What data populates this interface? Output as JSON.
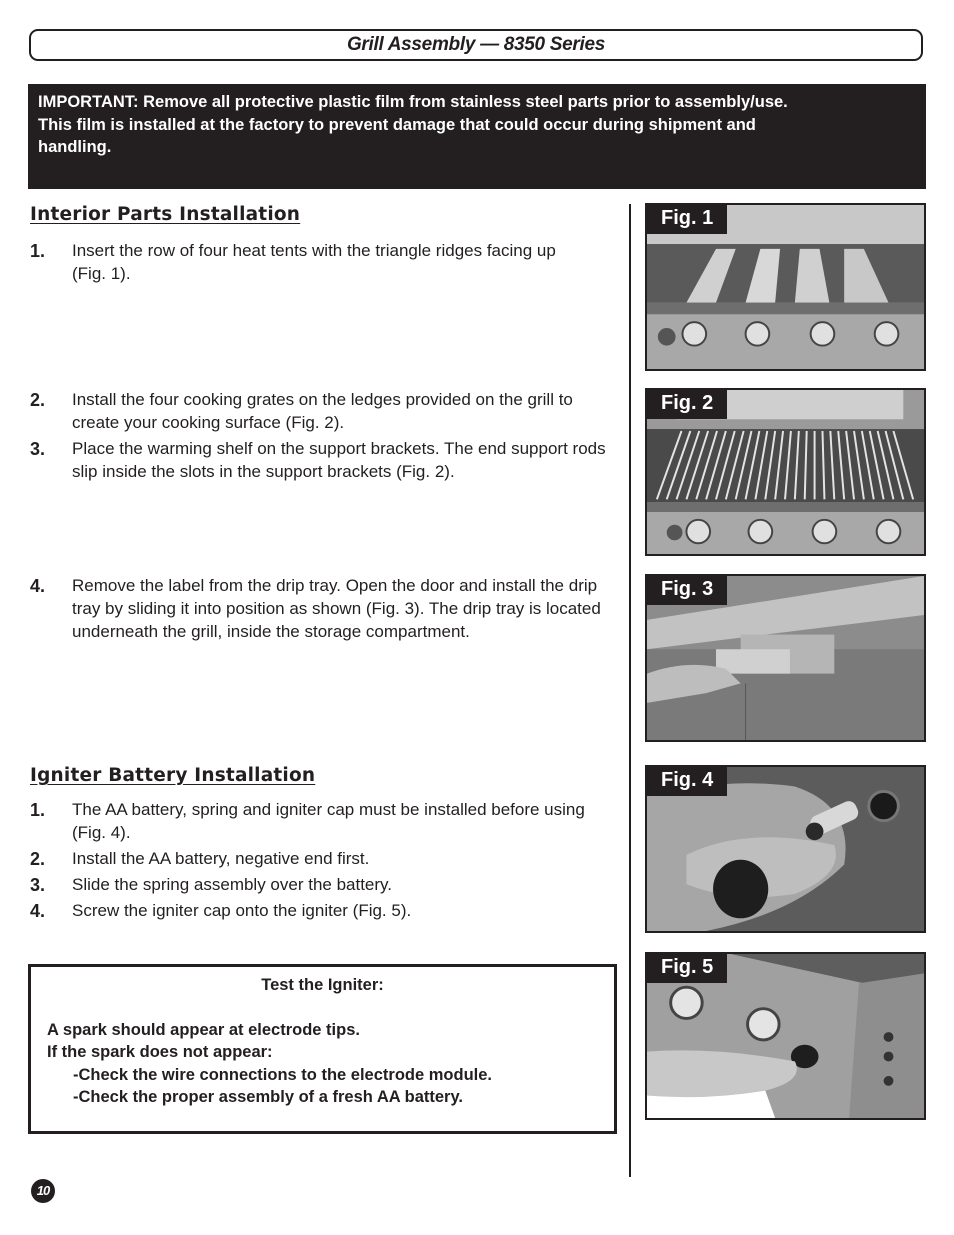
{
  "header": {
    "title": "Grill Assembly — 8350 Series"
  },
  "important_notice": {
    "lines": [
      "IMPORTANT: Remove all protective plastic film from stainless steel parts prior to assembly/use.",
      "This film is installed at the factory to prevent damage that could occur during shipment and",
      "handling."
    ]
  },
  "interior_section": {
    "heading": "Interior Parts Installation",
    "steps": [
      {
        "num": "1.",
        "text": "Insert the row of four heat tents with the triangle ridges facing up (Fig. 1)."
      },
      {
        "num": "2.",
        "text": "Install the four cooking grates on the ledges provided on the grill to create your cooking surface (Fig. 2)."
      },
      {
        "num": "3.",
        "text": "Place the warming shelf on the support brackets. The end support rods slip inside the slots in the support brackets (Fig. 2)."
      },
      {
        "num": "4.",
        "text": "Remove the label from the drip tray.  Open the door and install the drip tray by sliding it into position as shown (Fig. 3). The drip tray is located underneath the grill, inside the storage compartment."
      }
    ]
  },
  "igniter_section": {
    "heading": "Igniter Battery Installation",
    "steps": [
      {
        "num": "1.",
        "text": "The AA battery, spring and igniter cap must be installed before using (Fig. 4)."
      },
      {
        "num": "2.",
        "text": "Install the AA battery, negative end first."
      },
      {
        "num": "3.",
        "text": "Slide the spring assembly over the battery."
      },
      {
        "num": "4.",
        "text": "Screw the igniter cap onto the igniter (Fig. 5)."
      }
    ]
  },
  "test_box": {
    "heading": "Test the Igniter:",
    "line1": "A spark should appear at electrode tips.",
    "line2": "If the spark does not appear:",
    "check1": "-Check the wire connections to the electrode module.",
    "check2": "-Check the proper assembly of a fresh AA battery."
  },
  "figures": [
    {
      "label": "Fig. 1",
      "subject": "heat tents installed in grill"
    },
    {
      "label": "Fig. 2",
      "subject": "cooking grates and warming shelf"
    },
    {
      "label": "Fig. 3",
      "subject": "installing drip tray"
    },
    {
      "label": "Fig. 4",
      "subject": "AA battery and igniter cap"
    },
    {
      "label": "Fig. 5",
      "subject": "screwing igniter cap onto igniter"
    }
  ],
  "page_number": "10"
}
